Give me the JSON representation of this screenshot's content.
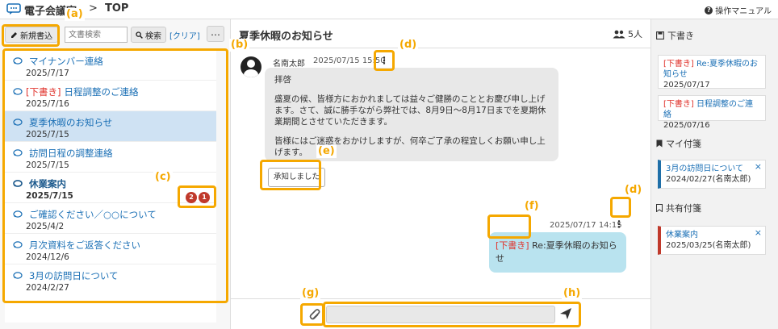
{
  "header": {
    "app_title": "電子会議室",
    "separator": ">",
    "crumb": "TOP",
    "help_label": "操作マニュアル"
  },
  "left": {
    "new_button_label": "新規書込",
    "search_placeholder": "文書検索",
    "search_button_label": "検索",
    "clear_label": "[クリア]",
    "more_label": "…",
    "threads": [
      {
        "draft": "",
        "title": "マイナンバー連絡",
        "date": "2025/7/17"
      },
      {
        "draft": "[下書き]",
        "title": "日程調整のご連絡",
        "date": "2025/7/16"
      },
      {
        "draft": "",
        "title": "夏季休暇のお知らせ",
        "date": "2025/7/15"
      },
      {
        "draft": "",
        "title": "訪問日程の調整連絡",
        "date": "2025/7/15"
      },
      {
        "draft": "",
        "title": "休業案内",
        "date": "2025/7/15",
        "badges": [
          "2",
          "1"
        ]
      },
      {
        "draft": "",
        "title": "ご確認ください／○○について",
        "date": "2025/4/2"
      },
      {
        "draft": "",
        "title": "月次資料をご返答ください",
        "date": "2024/12/6"
      },
      {
        "draft": "",
        "title": "3月の訪問日について",
        "date": "2024/2/27"
      }
    ]
  },
  "center": {
    "title": "夏季休暇のお知らせ",
    "member_count": "5人",
    "incoming": {
      "sender": "名南太郎",
      "time": "2025/07/15 15:50",
      "paragraphs": [
        "拝啓",
        "盛夏の候、皆様方におかれましては益々ご健勝のこととお慶び申し上げます。さて、誠に勝手ながら弊社では、8月9日～8月17日までを夏期休業期間とさせていただきます。",
        "皆様にはご迷惑をおかけしますが、何卒ご了承の程宜しくお願い申し上げます。"
      ],
      "ack_label": "承知しました"
    },
    "outgoing": {
      "time": "2025/07/17 14:15",
      "draft": "[下書き]",
      "text": "Re:夏季休暇のお知らせ"
    }
  },
  "right": {
    "drafts_heading": "下書き",
    "drafts": [
      {
        "draft": "[下書き]",
        "title": "Re:夏季休暇のお知らせ",
        "date": "2025/07/17"
      },
      {
        "draft": "[下書き]",
        "title": "日程調整のご連絡",
        "date": "2025/07/16"
      }
    ],
    "my_tags_heading": "マイ付箋",
    "my_tags": [
      {
        "title": "3月の訪問日について",
        "meta": "2024/02/27(名南太郎)"
      }
    ],
    "shared_tags_heading": "共有付箋",
    "shared_tags": [
      {
        "title": "休業案内",
        "meta": "2025/03/25(名南太郎)"
      }
    ]
  },
  "annotations": {
    "a": "(a)",
    "b": "(b)",
    "c": "(c)",
    "d1": "(d)",
    "d2": "(d)",
    "e": "(e)",
    "f": "(f)",
    "g": "(g)",
    "h": "(h)"
  },
  "colors": {
    "accent": "#f5a800",
    "link": "#1a6fb5",
    "draft_red": "#e0332c",
    "selected": "#cfe2f3",
    "outgoing_bubble": "#b9e3ef"
  }
}
